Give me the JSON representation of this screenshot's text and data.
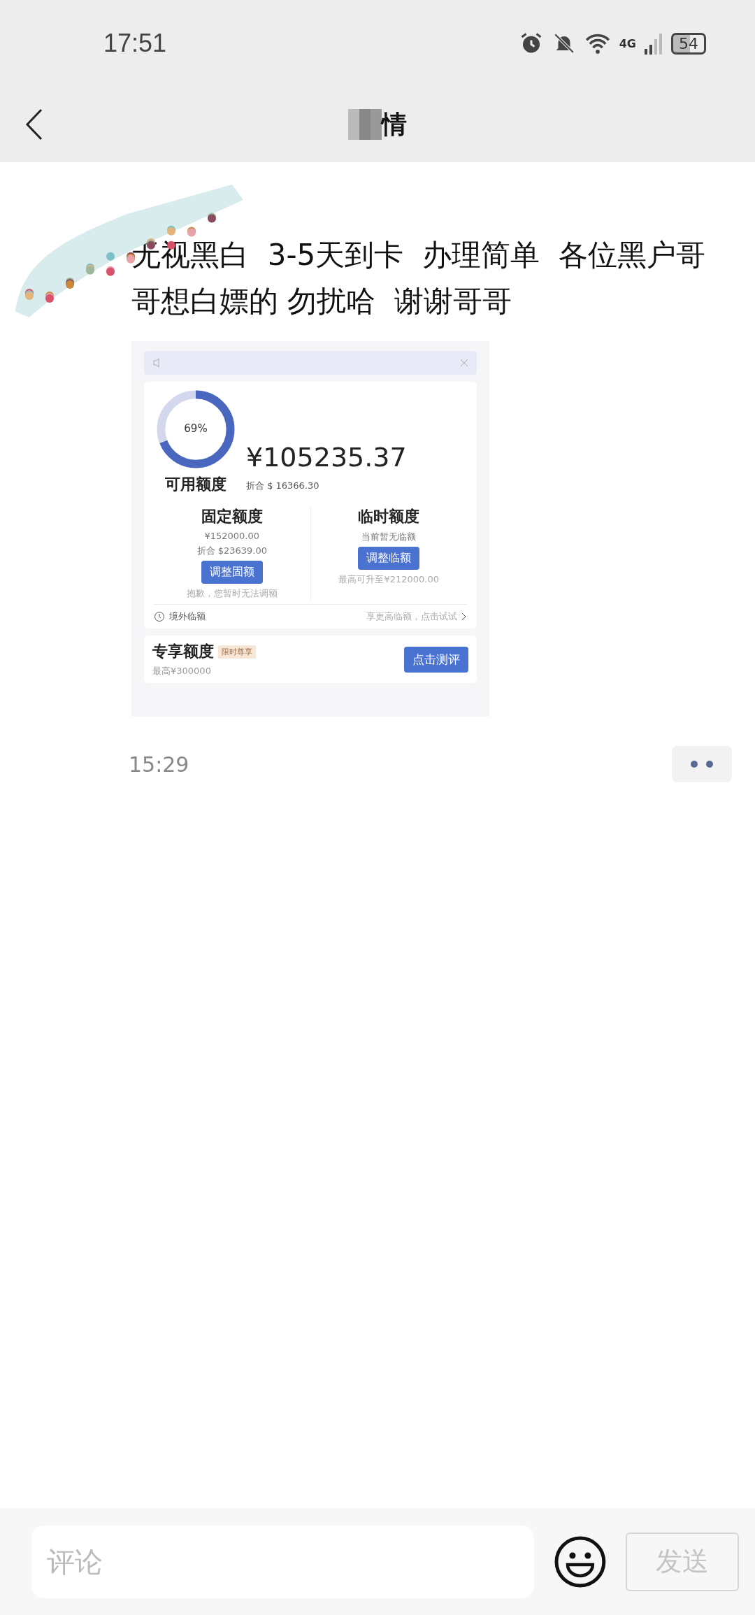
{
  "status_bar": {
    "time": "17:51",
    "network": "4G",
    "battery": "54"
  },
  "header": {
    "title": "情"
  },
  "post": {
    "text": "无视黑白  3-5天到卡  办理简单  各位黑户哥哥想白嫖的 勿扰哈  谢谢哥哥",
    "time": "15:29",
    "screenshot": {
      "ring": {
        "label": "69%"
      },
      "amount": "¥105235.37",
      "amount_label": "可用额度",
      "amount_usd": "折合 $ 16366.30",
      "columns": [
        {
          "title": "固定额度",
          "lines": [
            "¥152000.00",
            "折合 $23639.00"
          ],
          "button": "调整固额",
          "note": "抱歉，您暂时无法调额"
        },
        {
          "title": "临时额度",
          "lines": [
            "当前暂无临额"
          ],
          "button": "调整临额",
          "note": "最高可升至¥212000.00"
        }
      ],
      "overseas": {
        "label": "境外临额",
        "link": "享更高临额，点击试试"
      },
      "exclusive": {
        "title": "专享额度",
        "tag": "限时尊享",
        "sub": "最高¥300000",
        "button": "点击测评"
      }
    }
  },
  "comment_bar": {
    "placeholder": "评论",
    "send": "发送"
  }
}
